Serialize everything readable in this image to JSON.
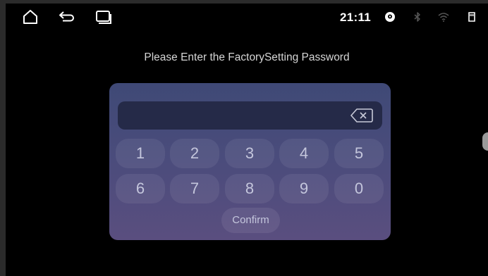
{
  "status_bar": {
    "time": "21:11",
    "icons": [
      "home-icon",
      "back-icon",
      "recent-apps-icon",
      "gps-icon",
      "bluetooth-icon",
      "wifi-icon",
      "sd-card-icon"
    ]
  },
  "prompt": "Please Enter the FactorySetting Password",
  "password": {
    "value": ""
  },
  "keys": [
    "1",
    "2",
    "3",
    "4",
    "5",
    "6",
    "7",
    "8",
    "9",
    "0"
  ],
  "confirm_label": "Confirm",
  "colors": {
    "panel_top": "#3f4976",
    "panel_bottom": "#5a4e7f",
    "field": "#252a48",
    "key_text": "#c4c6dc"
  }
}
